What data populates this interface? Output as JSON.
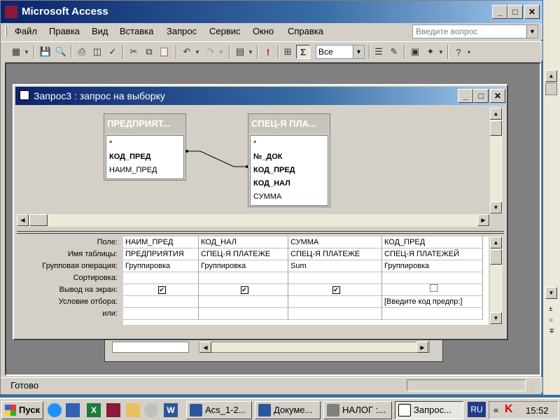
{
  "app": {
    "title": "Microsoft Access"
  },
  "menu": {
    "items": [
      "Файл",
      "Правка",
      "Вид",
      "Вставка",
      "Запрос",
      "Сервис",
      "Окно",
      "Справка"
    ],
    "help_placeholder": "Введите вопрос"
  },
  "toolbar": {
    "top_values": "Все",
    "sum_symbol": "Σ"
  },
  "query_window": {
    "title": "Запрос3 : запрос на выборку",
    "tables": [
      {
        "name": "ПРЕДПРИЯТ...",
        "fields": [
          "*",
          "КОД_ПРЕД",
          "НАИМ_ПРЕД"
        ]
      },
      {
        "name": "СПЕЦ-Я ПЛА...",
        "fields": [
          "*",
          "№_ДОК",
          "КОД_ПРЕД",
          "КОД_НАЛ",
          "СУММА"
        ]
      }
    ],
    "row_labels": [
      "Поле:",
      "Имя таблицы:",
      "Групповая операция:",
      "Сортировка:",
      "Вывод на экран:",
      "Условие отбора:",
      "или:"
    ],
    "columns": [
      {
        "field": "НАИМ_ПРЕД",
        "table": "ПРЕДПРИЯТИЯ",
        "group": "Группировка",
        "sort": "",
        "show": true,
        "criteria": "",
        "or": ""
      },
      {
        "field": "КОД_НАЛ",
        "table": "СПЕЦ-Я ПЛАТЕЖЕ",
        "group": "Группировка",
        "sort": "",
        "show": true,
        "criteria": "",
        "or": ""
      },
      {
        "field": "СУММА",
        "table": "СПЕЦ-Я ПЛАТЕЖЕ",
        "group": "Sum",
        "sort": "",
        "show": true,
        "criteria": "",
        "or": ""
      },
      {
        "field": "КОД_ПРЕД",
        "table": "СПЕЦ-Я ПЛАТЕЖЕЙ",
        "group": "Группировка",
        "sort": "",
        "show": false,
        "criteria": "[Введите код предпр:]",
        "or": ""
      }
    ]
  },
  "status": {
    "text": "Готово"
  },
  "taskbar": {
    "start": "Пуск",
    "buttons": [
      "Acs_1-2...",
      "Докуме...",
      "НАЛОГ :...",
      "Запрос..."
    ],
    "lang": "RU",
    "clock": "15:52"
  },
  "colors": {
    "title_active": "#0a246a",
    "desktop": "#3a6ea5",
    "face": "#d4d0c8"
  }
}
